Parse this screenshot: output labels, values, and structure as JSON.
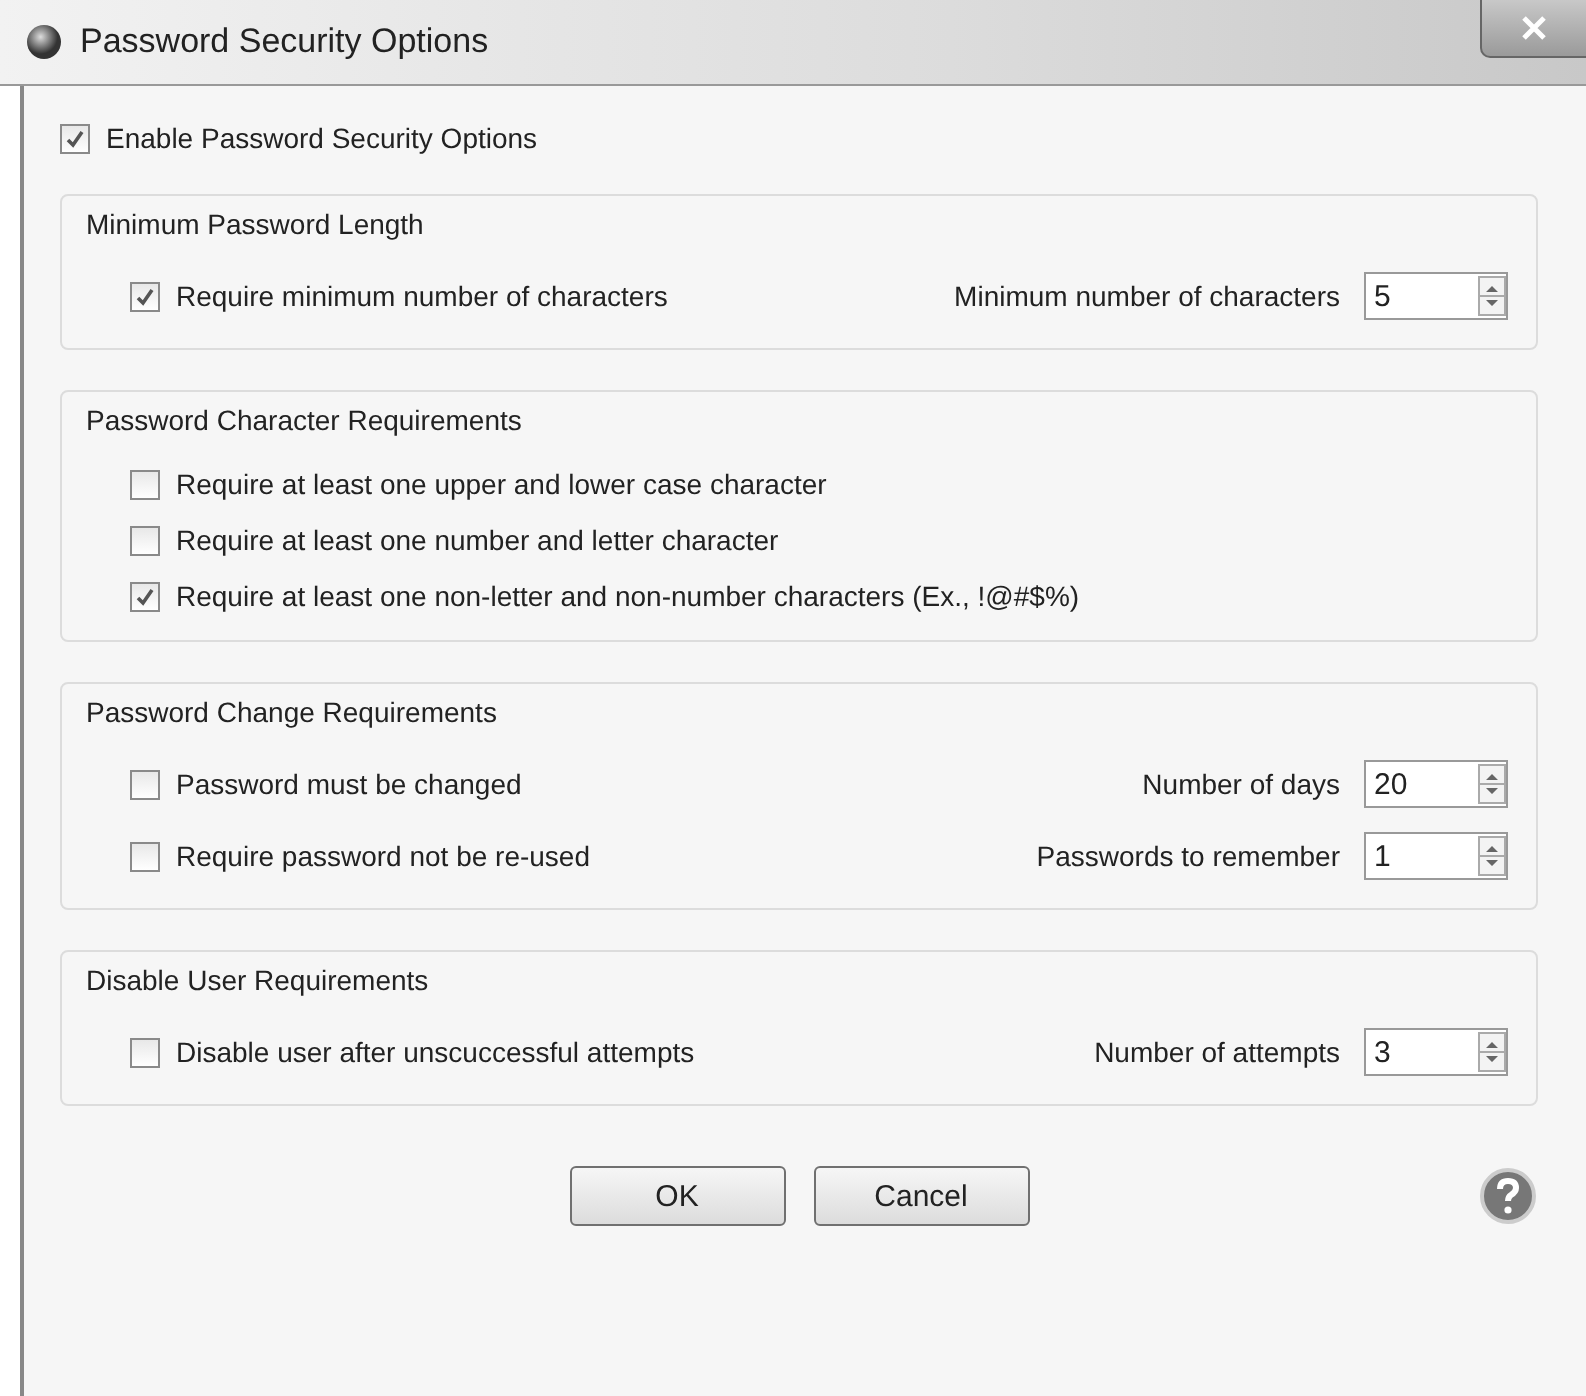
{
  "window": {
    "title": "Password Security Options"
  },
  "enable": {
    "label": "Enable Password Security Options",
    "checked": true
  },
  "groups": [
    {
      "title": "Minimum Password Length",
      "rows": [
        {
          "label": "Require minimum number of characters",
          "checked": true,
          "field": {
            "label": "Minimum number of characters",
            "value": "5"
          }
        }
      ]
    },
    {
      "title": "Password Character Requirements",
      "rows": [
        {
          "label": "Require at least one upper and lower case character",
          "checked": false
        },
        {
          "label": "Require at least one number and letter character",
          "checked": false
        },
        {
          "label": "Require at least one non-letter and non-number characters (Ex., !@#$%)",
          "checked": true
        }
      ]
    },
    {
      "title": "Password Change Requirements",
      "rows": [
        {
          "label": "Password must be changed",
          "checked": false,
          "field": {
            "label": "Number of days",
            "value": "20"
          }
        },
        {
          "label": "Require password not be re-used",
          "checked": false,
          "field": {
            "label": "Passwords to remember",
            "value": "1"
          }
        }
      ]
    },
    {
      "title": "Disable User Requirements",
      "rows": [
        {
          "label": "Disable user after unscuccessful attempts",
          "checked": false,
          "field": {
            "label": "Number of attempts",
            "value": "3"
          }
        }
      ]
    }
  ],
  "buttons": [
    {
      "label": "OK"
    },
    {
      "label": "Cancel"
    }
  ]
}
